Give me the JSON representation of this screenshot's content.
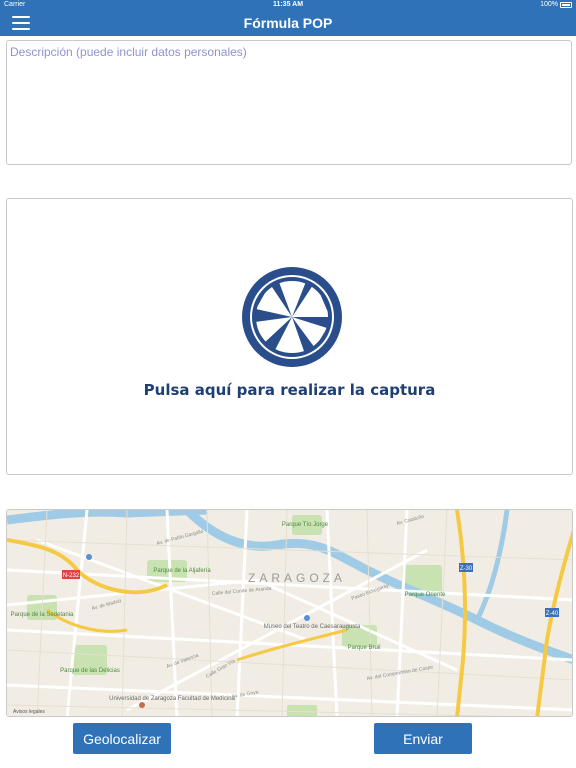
{
  "status_bar": {
    "carrier": "Carrier",
    "time": "11:35 AM",
    "battery": "100%"
  },
  "nav": {
    "title": "Fórmula POP"
  },
  "description": {
    "placeholder": "Descripción (puede incluir datos personales)"
  },
  "capture": {
    "label": "Pulsa aquí para realizar la captura"
  },
  "map": {
    "city_label": "ZARAGOZA",
    "legal": "Avisos legales",
    "road_shields": [
      "N-232",
      "Z-30",
      "Z-40"
    ],
    "places": [
      "Parque Tío Jorge",
      "Parque de la Aljafería",
      "Parque de la Sedetania",
      "Parque de las Delicias",
      "Parque Oriente",
      "Parque Bruil",
      "Museo del Teatro de Caesaraugusta",
      "Universidad de Zaragoza Facultad de Medicina"
    ],
    "streets": [
      "Av. de Madrid",
      "Calle del Conde de Aranda",
      "Av. de Valencia",
      "Av. de Goya",
      "Av. Cataluña",
      "Av. del Compromiso de Caspe",
      "Av. de Pablo Gargallo",
      "Calle Gran Vía",
      "Paseo Echegaray"
    ],
    "colors": {
      "land": "#f1ede4",
      "park": "#c8e2b2",
      "water": "#9fcbe6",
      "highway": "#f6c945",
      "road": "#ffffff"
    }
  },
  "buttons": {
    "geolocate": "Geolocalizar",
    "send": "Enviar"
  },
  "colors": {
    "primary": "#2f72b7",
    "aperture": "#2a4e8c"
  }
}
